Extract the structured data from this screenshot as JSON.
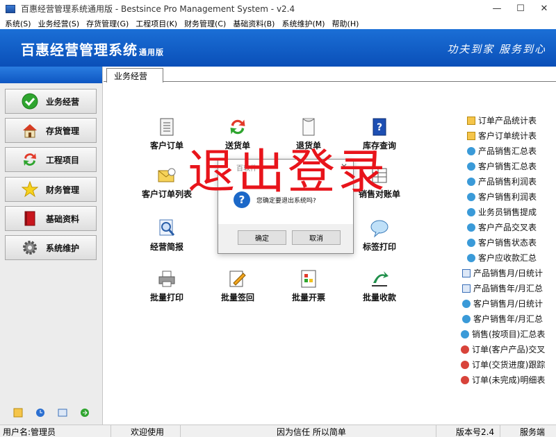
{
  "window": {
    "title": "百惠经营管理系统通用版 - Bestsince Pro Management System - v2.4",
    "controls": [
      "—",
      "☐",
      "✕"
    ]
  },
  "menu": [
    "系统(S)",
    "业务经营(S)",
    "存货管理(G)",
    "工程项目(K)",
    "财务管理(C)",
    "基础资料(B)",
    "系统维护(M)",
    "帮助(H)"
  ],
  "banner": {
    "title": "百惠经营管理系统",
    "subtitle": "通用版",
    "slogan": "功夫到家 服务到心"
  },
  "nav": [
    {
      "label": "业务经营",
      "icon": "green-check-icon"
    },
    {
      "label": "存货管理",
      "icon": "house-icon"
    },
    {
      "label": "工程项目",
      "icon": "cycle-arrows-icon"
    },
    {
      "label": "财务管理",
      "icon": "star-icon"
    },
    {
      "label": "基础资料",
      "icon": "red-book-icon"
    },
    {
      "label": "系统维护",
      "icon": "gear-icon"
    }
  ],
  "tab": {
    "label": "业务经营"
  },
  "functions": [
    {
      "label": "客户订单",
      "icon": "document-icon"
    },
    {
      "label": "送货单",
      "icon": "cycle-arrows-icon"
    },
    {
      "label": "退货单",
      "icon": "paper-icon"
    },
    {
      "label": "库存查询",
      "icon": "help-book-icon"
    },
    {
      "label": "客户订单列表",
      "icon": "envelope-icon"
    },
    {
      "label": "销售对账单",
      "icon": "ledger-icon"
    },
    {
      "label": "经营简报",
      "icon": "magnifier-icon"
    },
    {
      "label": "标签打印",
      "icon": "speech-bubble-icon"
    },
    {
      "label": "批量打印",
      "icon": "printer-icon"
    },
    {
      "label": "批量签回",
      "icon": "pen-paper-icon"
    },
    {
      "label": "批量开票",
      "icon": "invoice-icon"
    },
    {
      "label": "批量收款",
      "icon": "collect-arrow-icon"
    }
  ],
  "reports": [
    {
      "label": "订单产品统计表",
      "icon": "folder-icon"
    },
    {
      "label": "客户订单统计表",
      "icon": "folder-icon"
    },
    {
      "label": "产品销售汇总表",
      "icon": "globe-icon"
    },
    {
      "label": "客户销售汇总表",
      "icon": "globe-icon"
    },
    {
      "label": "产品销售利润表",
      "icon": "globe-icon"
    },
    {
      "label": "客户销售利润表",
      "icon": "globe-icon"
    },
    {
      "label": "业务员销售提成",
      "icon": "globe-icon"
    },
    {
      "label": "客户产品交叉表",
      "icon": "globe-icon"
    },
    {
      "label": "客户销售状态表",
      "icon": "globe-icon"
    },
    {
      "label": "客户应收款汇总",
      "icon": "globe-icon"
    },
    {
      "label": "产品销售月/日统计",
      "icon": "window-icon"
    },
    {
      "label": "产品销售年/月汇总",
      "icon": "window-icon"
    },
    {
      "label": "客户销售月/日统计",
      "icon": "globe-icon"
    },
    {
      "label": "客户销售年/月汇总",
      "icon": "globe-icon"
    },
    {
      "label": "销售(按项目)汇总表",
      "icon": "globe-icon"
    },
    {
      "label": "订单(客户产品)交叉",
      "icon": "globe-red-icon"
    },
    {
      "label": "订单(交货进度)跟踪",
      "icon": "globe-red-icon"
    },
    {
      "label": "订单(未完成)明细表",
      "icon": "globe-red-icon"
    }
  ],
  "overlay": {
    "text": "退出登录"
  },
  "dialog": {
    "title": "百软件",
    "message": "您确定要退出系统吗?",
    "ok": "确定",
    "cancel": "取消"
  },
  "status": {
    "user": "用户名:管理员",
    "welcome": "欢迎使用",
    "motto": "因为信任 所以简单",
    "version": "版本号2.4",
    "server": "服务端"
  },
  "colors": {
    "banner": "#1b6fd6",
    "overlay_text": "#e8141b",
    "dialog_icon": "#1c68c8"
  }
}
